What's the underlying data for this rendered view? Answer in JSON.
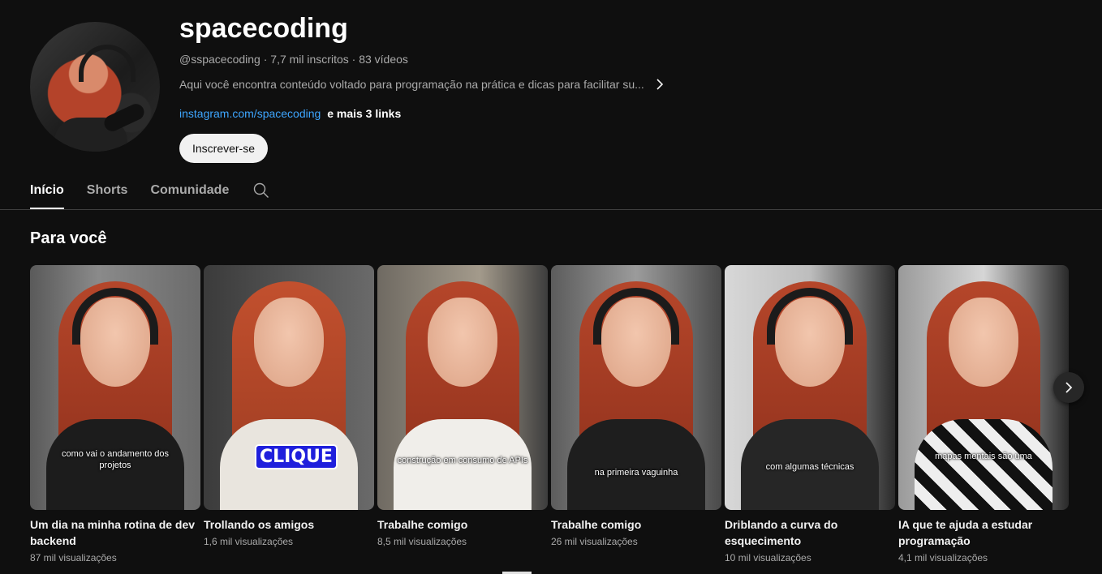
{
  "channel": {
    "name": "spacecoding",
    "handle": "@sspacecoding",
    "subscribers": "7,7 mil inscritos",
    "videos": "83 vídeos",
    "description": "Aqui você encontra conteúdo voltado para programação na prática e dicas para facilitar su...",
    "link_primary": "instagram.com/spacecoding",
    "link_more": "e mais 3 links",
    "subscribe_label": "Inscrever-se"
  },
  "tabs": [
    {
      "label": "Início",
      "active": true
    },
    {
      "label": "Shorts",
      "active": false
    },
    {
      "label": "Comunidade",
      "active": false
    }
  ],
  "section": {
    "title": "Para você"
  },
  "shorts": [
    {
      "title": "Um dia na minha rotina de dev backend",
      "views": "87 mil visualizações",
      "caption": "como vai o andamento dos projetos"
    },
    {
      "title": "Trollando os amigos",
      "views": "1,6 mil visualizações",
      "caption": "CLIQUE"
    },
    {
      "title": "Trabalhe comigo",
      "views": "8,5 mil visualizações",
      "caption": "construção em consumo de APIs"
    },
    {
      "title": "Trabalhe comigo",
      "views": "26 mil visualizações",
      "caption": "na primeira vaguinha"
    },
    {
      "title": "Driblando a curva do esquecimento",
      "views": "10 mil visualizações",
      "caption": "com algumas técnicas"
    },
    {
      "title": "IA que te ajuda a estudar programação",
      "views": "4,1 mil visualizações",
      "caption": "mapas mentais são uma"
    }
  ],
  "icons": {
    "description_more": "chevron-right-icon",
    "tab_search": "search-icon",
    "shelf_next": "chevron-right-icon"
  },
  "colors": {
    "background": "#0f0f0f",
    "link": "#3ea6ff",
    "subscribe_bg": "#f1f1f1"
  }
}
